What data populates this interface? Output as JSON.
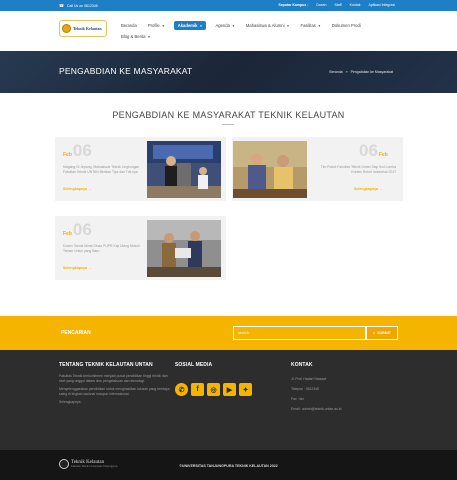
{
  "topbar": {
    "phone": "Call Us on 0812345",
    "phone_icon": "phone-icon",
    "links": [
      "Seputar Kampus :",
      "Dosen",
      "Staff",
      "Kontak",
      "Aplikasi Integrasi"
    ]
  },
  "header": {
    "logo_text": "Teknik Kelautan",
    "nav": [
      "Beranda",
      "Profile",
      "Akademik",
      "Agenda",
      "Mahasiswa & Alumni",
      "Fasilitas",
      "Dokumen Prodi",
      "Blog & Berita"
    ],
    "active_nav": "Akademik"
  },
  "title_band": {
    "title": "PENGABDIAN KE MASYARAKAT",
    "breadcrumb": [
      "Beranda",
      "»",
      "Pengabdian ke Masyarakat"
    ]
  },
  "main": {
    "section_title": "PENGABDIAN KE MASYARAKAT TEKNIK KELAUTAN",
    "cards": [
      {
        "month": "Feb",
        "day": "06",
        "text": "Magang Di Jepang, Mahasiswa Teknik Lingkungan Fakultas Teknik UNTAN Berikan Tips dan Trik nya",
        "more": "Selengkapnya →"
      },
      {
        "month": "Feb",
        "day": "06",
        "text": "Tim Robot Fakultas Teknik Untan Siap Ikut Lomba Kontes Robot Indonesia 2017",
        "more": "Selengkapnya →"
      },
      {
        "month": "Feb",
        "day": "06",
        "text": "Dosen Teknik Minta Dinas PUPR Kaji Ulang Musuh Taman Untuk yang Baru",
        "more": "Selengkapnya →"
      }
    ],
    "colors": {
      "accent": "#f0b000",
      "primary": "#1f7fc6"
    }
  },
  "search": {
    "label": "PENCARIAN",
    "placeholder": "search",
    "button": "SUBMIT",
    "button_icon": "search-icon"
  },
  "footer": {
    "about": {
      "title": "TENTANG TEKNIK KELAUTAN UNTAN",
      "lines": [
        "Fakultas Teknik berkomitmen menjadi pusat pendidikan tinggi teknik dan riset yang unggul dalam ilmu pengetahuan dan teknologi.",
        "Menyelenggarakan pendidikan untuk menghasilkan lulusan yang berdaya saing di tingkat nasional maupun internasional.",
        "Selengkapnya"
      ]
    },
    "social": {
      "title": "SOSIAL MEDIA",
      "icons": [
        "whatsapp-icon",
        "facebook-icon",
        "instagram-icon",
        "youtube-icon",
        "twitter-icon"
      ]
    },
    "contact": {
      "title": "KONTAK",
      "address": "Jl. Prof. Hadari Nawawi",
      "phone": "Telepon : 0812345",
      "fax": "Fax : fax",
      "email": "Email : admin@teknik.untan.ac.id"
    }
  },
  "bottombar": {
    "logo_text": "Teknik Kelautan",
    "logo_sub": "Fakultas Teknik Universitas Tanjungpura",
    "copyright": "©UNIVERSITAS TANJUNGPURA TEKNIK KELAUTAN 2022"
  }
}
